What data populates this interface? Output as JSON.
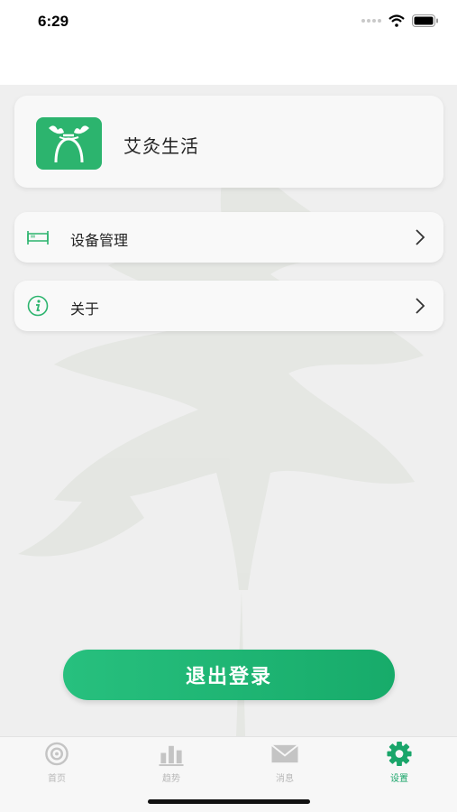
{
  "status_bar": {
    "time": "6:29"
  },
  "profile": {
    "app_name": "艾灸生活"
  },
  "menu": [
    {
      "label": "设备管理",
      "icon": "bed-icon"
    },
    {
      "label": "关于",
      "icon": "info-icon"
    }
  ],
  "logout_label": "退出登录",
  "tabs": [
    {
      "label": "首页",
      "icon": "home-target-icon",
      "active": false
    },
    {
      "label": "趋势",
      "icon": "bar-chart-icon",
      "active": false
    },
    {
      "label": "消息",
      "icon": "envelope-icon",
      "active": false
    },
    {
      "label": "设置",
      "icon": "gear-icon",
      "active": true
    }
  ],
  "colors": {
    "accent": "#1aa56a",
    "logo_bg": "#2cb46e",
    "background": "#efefef"
  }
}
